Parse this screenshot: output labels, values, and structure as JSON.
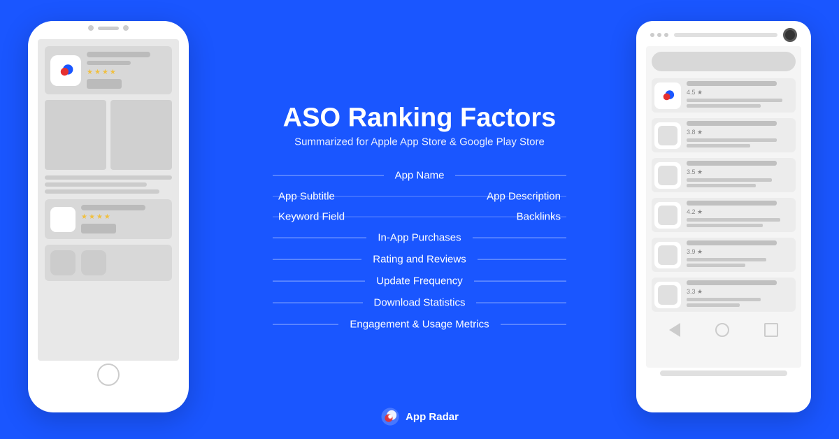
{
  "page": {
    "bg_color": "#1a56ff",
    "title": "ASO Ranking Factors",
    "subtitle": "Summarized for Apple App Store & Google Play Store"
  },
  "center": {
    "title": "ASO Ranking Factors",
    "subtitle": "Summarized for Apple App Store & Google Play Store",
    "factors": [
      {
        "id": "app-name",
        "label": "App Name",
        "type": "centered"
      },
      {
        "id": "app-subtitle",
        "label": "App Subtitle",
        "type": "left",
        "pair": "App Description",
        "pair_id": "app-description"
      },
      {
        "id": "keyword-field",
        "label": "Keyword Field",
        "type": "left-only"
      },
      {
        "id": "in-app-purchases",
        "label": "In-App Purchases",
        "type": "centered"
      },
      {
        "id": "rating-reviews",
        "label": "Rating and Reviews",
        "type": "centered"
      },
      {
        "id": "update-frequency",
        "label": "Update Frequency",
        "type": "centered"
      },
      {
        "id": "download-statistics",
        "label": "Download Statistics",
        "type": "centered"
      },
      {
        "id": "engagement-metrics",
        "label": "Engagement & Usage Metrics",
        "type": "centered"
      }
    ],
    "split_items": [
      {
        "left": "App Subtitle",
        "right": "App Description"
      },
      {
        "left": "Keyword Field",
        "right": "Backlinks"
      }
    ]
  },
  "iphone": {
    "app_icon_present": true,
    "ratings": [
      "★★★★",
      "★★★★"
    ],
    "app_name_placeholder": "App Name Bar"
  },
  "android": {
    "ratings": [
      "4.5 ★",
      "3.8 ★",
      "3.5 ★",
      "4.2 ★",
      "3.9 ★",
      "3.3 ★"
    ]
  },
  "logo": {
    "brand": "App Radar",
    "icon": "radar"
  }
}
